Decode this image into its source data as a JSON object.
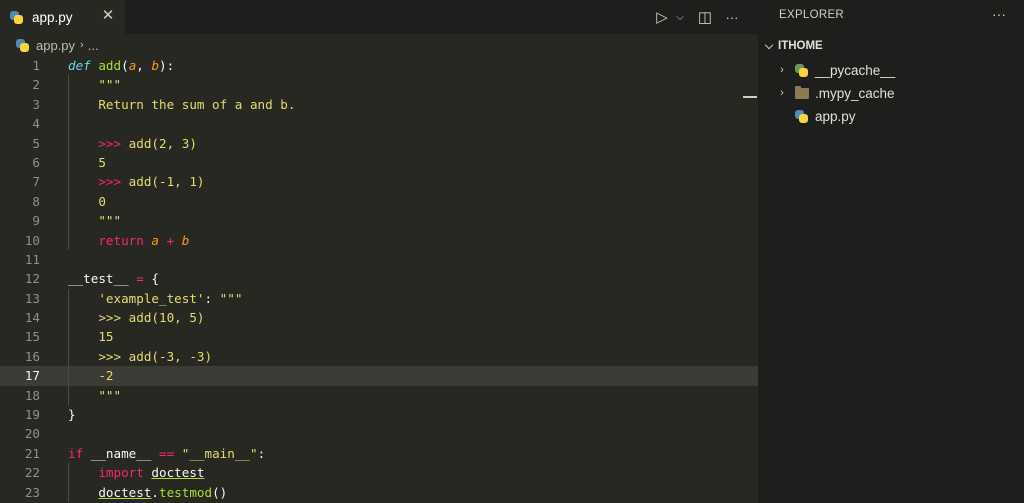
{
  "tab": {
    "label": "app.py",
    "close": "✕"
  },
  "editor_actions": {
    "run": "▷",
    "run_menu": "⌵",
    "split": "◫",
    "more": "···"
  },
  "breadcrumb": {
    "file": "app.py",
    "separator": "›",
    "ellipsis": "..."
  },
  "code": {
    "current_line": 17,
    "lines": [
      {
        "n": "1",
        "tokens": [
          [
            "kwi",
            "def"
          ],
          [
            "pl",
            " "
          ],
          [
            "fn",
            "add"
          ],
          [
            "pl",
            "("
          ],
          [
            "pa",
            "a"
          ],
          [
            "pl",
            ", "
          ],
          [
            "pa",
            "b"
          ],
          [
            "pl",
            "):"
          ]
        ]
      },
      {
        "n": "2",
        "tokens": [
          [
            "str",
            "    \"\"\""
          ]
        ]
      },
      {
        "n": "3",
        "tokens": [
          [
            "str",
            "    Return the sum of a and b."
          ]
        ]
      },
      {
        "n": "4",
        "tokens": [
          [
            "str",
            ""
          ]
        ]
      },
      {
        "n": "5",
        "tokens": [
          [
            "kw",
            "    >>> "
          ],
          [
            "str",
            "add(2, 3)"
          ]
        ]
      },
      {
        "n": "6",
        "tokens": [
          [
            "str",
            "    5"
          ]
        ]
      },
      {
        "n": "7",
        "tokens": [
          [
            "kw",
            "    >>> "
          ],
          [
            "str",
            "add(-1, 1)"
          ]
        ]
      },
      {
        "n": "8",
        "tokens": [
          [
            "str",
            "    0"
          ]
        ]
      },
      {
        "n": "9",
        "tokens": [
          [
            "str",
            "    \"\"\""
          ]
        ]
      },
      {
        "n": "10",
        "tokens": [
          [
            "kw",
            "    return "
          ],
          [
            "pa",
            "a"
          ],
          [
            "op",
            " + "
          ],
          [
            "pa",
            "b"
          ]
        ]
      },
      {
        "n": "11",
        "tokens": [
          [
            "pl",
            ""
          ]
        ]
      },
      {
        "n": "12",
        "tokens": [
          [
            "pl",
            "__test__"
          ],
          [
            "op",
            " = "
          ],
          [
            "pl",
            "{"
          ]
        ]
      },
      {
        "n": "13",
        "tokens": [
          [
            "str",
            "    'example_test'"
          ],
          [
            "pl",
            ": "
          ],
          [
            "str",
            "\"\"\""
          ]
        ]
      },
      {
        "n": "14",
        "tokens": [
          [
            "str",
            "    >>> add(10, 5)"
          ]
        ]
      },
      {
        "n": "15",
        "tokens": [
          [
            "str",
            "    15"
          ]
        ]
      },
      {
        "n": "16",
        "tokens": [
          [
            "str",
            "    >>> add(-3, -3)"
          ]
        ]
      },
      {
        "n": "17",
        "tokens": [
          [
            "str",
            "    -2"
          ]
        ]
      },
      {
        "n": "18",
        "tokens": [
          [
            "str",
            "    \"\"\""
          ]
        ]
      },
      {
        "n": "19",
        "tokens": [
          [
            "pl",
            "}"
          ]
        ]
      },
      {
        "n": "20",
        "tokens": [
          [
            "pl",
            ""
          ]
        ]
      },
      {
        "n": "21",
        "tokens": [
          [
            "kw",
            "if"
          ],
          [
            "pl",
            " __name__ "
          ],
          [
            "op",
            "=="
          ],
          [
            "pl",
            " "
          ],
          [
            "str",
            "\"__main__\""
          ],
          [
            "pl",
            ":"
          ]
        ]
      },
      {
        "n": "22",
        "tokens": [
          [
            "kw",
            "    import "
          ],
          [
            "ul",
            "doctest"
          ]
        ]
      },
      {
        "n": "23",
        "tokens": [
          [
            "pl",
            "    "
          ],
          [
            "ul",
            "doctest"
          ],
          [
            "pl",
            "."
          ],
          [
            "fn",
            "testmod"
          ],
          [
            "pl",
            "()"
          ]
        ]
      }
    ]
  },
  "explorer": {
    "title": "EXPLORER",
    "more": "···",
    "root": {
      "label": "ITHOME",
      "chevron": "⌵"
    },
    "items": [
      {
        "label": "__pycache__",
        "chevron": "›",
        "icon": "python-folder-icon"
      },
      {
        "label": ".mypy_cache",
        "chevron": "›",
        "icon": "folder-icon"
      },
      {
        "label": "app.py",
        "chevron": "",
        "icon": "python-file-icon"
      }
    ]
  },
  "colors": {
    "editor_bg": "#272822",
    "sidebar_bg": "#1e1f1c",
    "keyword": "#f92672",
    "function": "#a6e22e",
    "string": "#e6db74",
    "parameter": "#fd971f",
    "storage": "#66d9ef"
  }
}
